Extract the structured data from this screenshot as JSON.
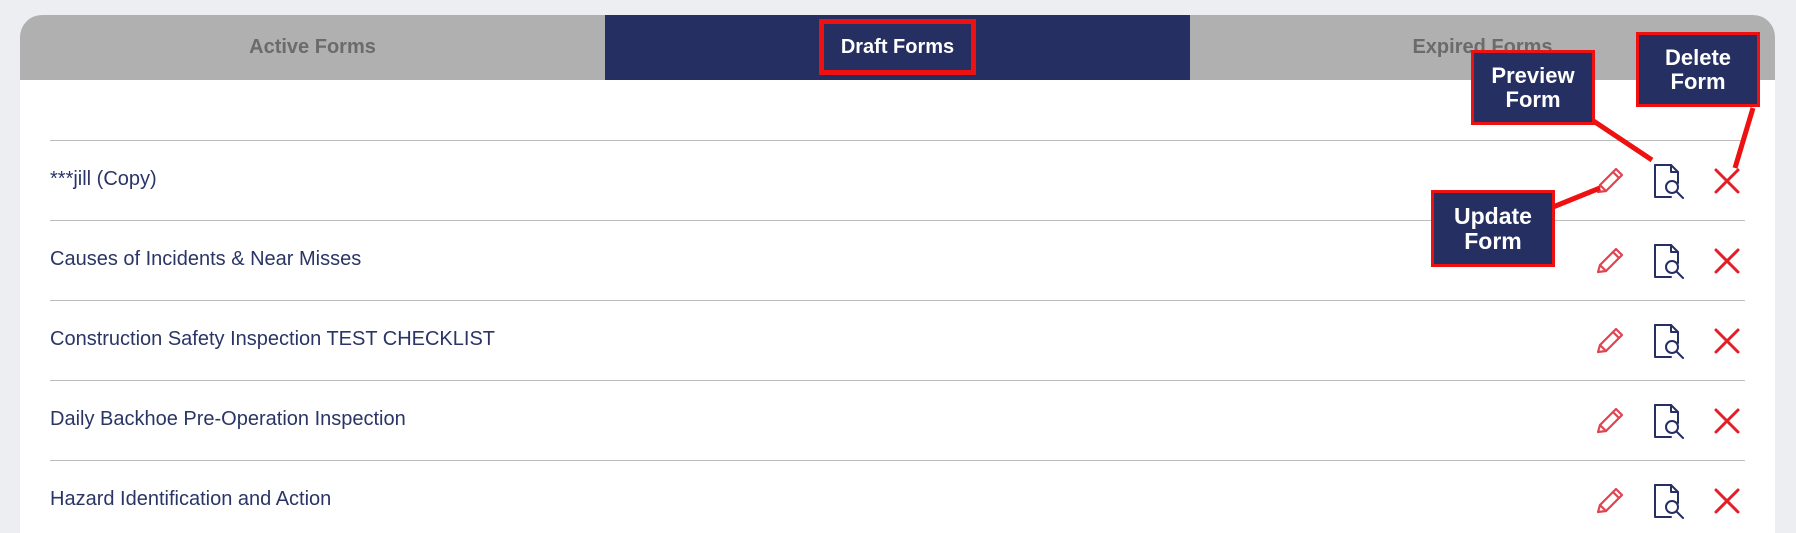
{
  "tabs": [
    {
      "label": "Active Forms",
      "active": false
    },
    {
      "label": "Draft Forms",
      "active": true
    },
    {
      "label": "Expired Forms",
      "active": false
    }
  ],
  "forms": [
    {
      "title": "***jill (Copy)"
    },
    {
      "title": "Causes of Incidents & Near Misses"
    },
    {
      "title": "Construction Safety Inspection TEST CHECKLIST"
    },
    {
      "title": "Daily Backhoe Pre-Operation Inspection"
    },
    {
      "title": "Hazard Identification and Action"
    }
  ],
  "actions": {
    "edit_icon": "pencil-icon",
    "preview_icon": "document-magnifier-icon",
    "delete_icon": "close-x-icon"
  },
  "annotations": {
    "preview": "Preview Form",
    "delete": "Delete Form",
    "update": "Update Form"
  },
  "colors": {
    "navy": "#252f62",
    "tab_gray": "#b0b0b0",
    "highlight_red": "#ee1111",
    "edit_red": "#e0454f",
    "delete_red": "#e41e26",
    "text_navy": "#2a3566"
  }
}
